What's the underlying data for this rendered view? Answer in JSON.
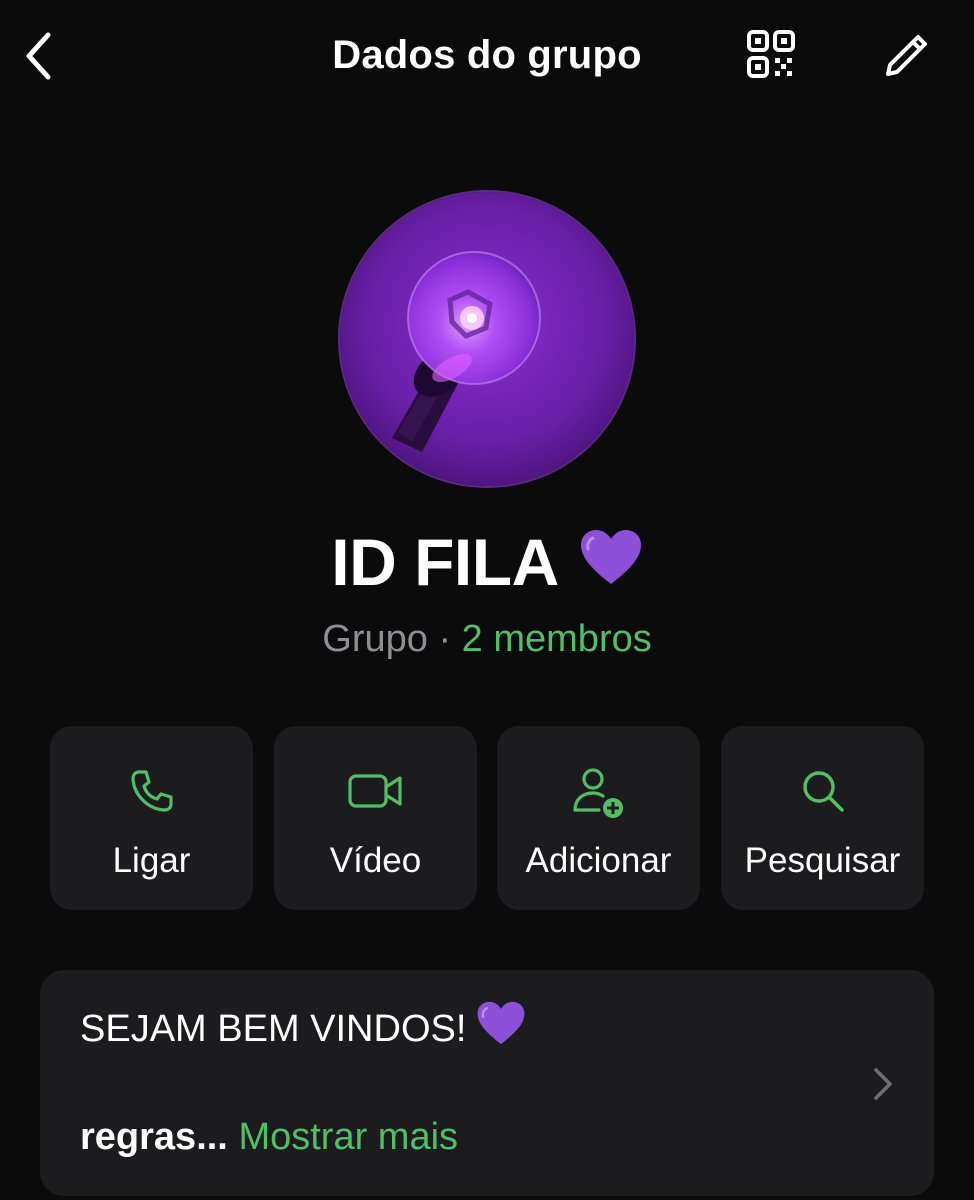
{
  "header": {
    "title": "Dados do grupo",
    "back_icon": "chevron-left-icon",
    "qr_icon": "qr-code-icon",
    "edit_icon": "pencil-icon"
  },
  "group": {
    "name": "ID FILA",
    "name_emoji": "purple-heart",
    "kind": "Grupo",
    "separator": "·",
    "members": "2 membros",
    "avatar": "purple-lightstick-photo"
  },
  "actions": [
    {
      "label": "Ligar",
      "icon": "phone-icon"
    },
    {
      "label": "Vídeo",
      "icon": "video-camera-icon"
    },
    {
      "label": "Adicionar",
      "icon": "add-person-icon"
    },
    {
      "label": "Pesquisar",
      "icon": "search-icon"
    }
  ],
  "description": {
    "line1": "SEJAM BEM VINDOS!",
    "line1_emoji": "purple-heart",
    "line2_text": "regras...",
    "show_more": "Mostrar mais"
  },
  "colors": {
    "background": "#0b0b0c",
    "card": "#1c1c1e",
    "accent_green": "#4fbf68",
    "muted_gray": "#8e8e93",
    "heart_purple": "#8e4fd9"
  }
}
